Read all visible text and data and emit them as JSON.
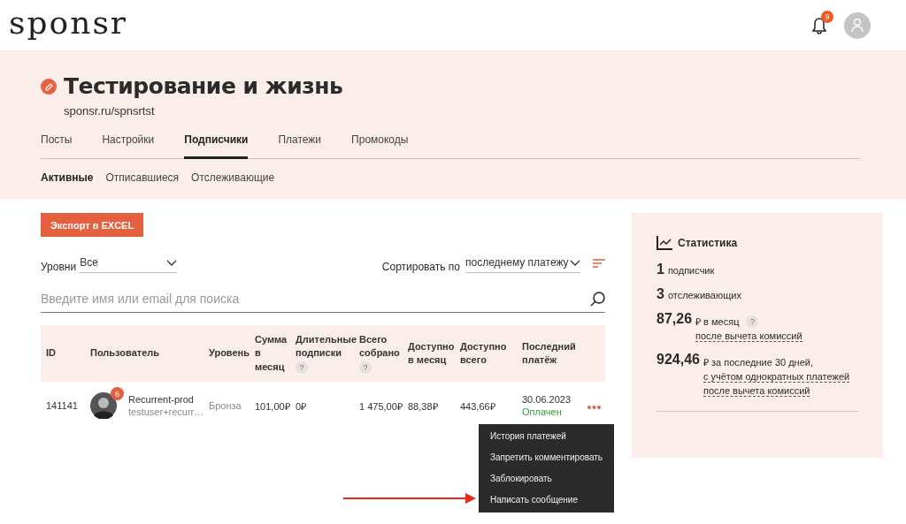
{
  "header": {
    "logo": "sponsr",
    "notification_count": "9"
  },
  "project": {
    "title": "Тестирование и жизнь",
    "url": "sponsr.ru/spnsrtst"
  },
  "tabs": [
    {
      "label": "Посты",
      "selected": false
    },
    {
      "label": "Настройки",
      "selected": false
    },
    {
      "label": "Подписчики",
      "selected": true
    },
    {
      "label": "Платежи",
      "selected": false
    },
    {
      "label": "Промокоды",
      "selected": false
    }
  ],
  "subtabs": [
    {
      "label": "Активные",
      "selected": true
    },
    {
      "label": "Отписавшиеся",
      "selected": false
    },
    {
      "label": "Отслеживающие",
      "selected": false
    }
  ],
  "export_button": "Экспорт в EXCEL",
  "filters": {
    "levels_label": "Уровни",
    "levels_value": "Все",
    "sort_label": "Сортировать по",
    "sort_value": "последнему платежу"
  },
  "search": {
    "placeholder": "Введите имя или email для поиска"
  },
  "table": {
    "columns": [
      {
        "label": "ID"
      },
      {
        "label": "Пользователь"
      },
      {
        "label": "Уровень"
      },
      {
        "label": "Сумма в месяц"
      },
      {
        "label": "Длительные подписки",
        "help": "?"
      },
      {
        "label": "Всего собрано",
        "help": "?"
      },
      {
        "label": "Доступно в месяц"
      },
      {
        "label": "Доступно всего"
      },
      {
        "label": "Последний платёж"
      }
    ],
    "rows": [
      {
        "id": "141141",
        "badge": "6",
        "name": "Recurrent-prod",
        "email": "testuser+recurr…",
        "level": "Бронза",
        "monthly": "101,00₽",
        "long_term": "0₽",
        "total": "1 475,00₽",
        "available_month": "88,38₽",
        "available_total": "443,66₽",
        "last_date": "30.06.2023",
        "status": "Оплачен",
        "paid": true
      }
    ]
  },
  "row_menu": {
    "items": [
      "История платежей",
      "Запретить комментировать",
      "Заблокировать",
      "Написать сообщение"
    ]
  },
  "stats": {
    "title": "Статистика",
    "lines": [
      {
        "value": "1",
        "text": "подписчик"
      },
      {
        "value": "3",
        "text": "отслеживающих"
      },
      {
        "value": "87,26",
        "text": "₽ в месяц",
        "help": "?",
        "notes": [
          "после вычета комиссий"
        ]
      },
      {
        "value": "924,46",
        "text": "₽ за последние 30 дней,",
        "notes": [
          "с учётом однократных платежей",
          "после вычета комиссий"
        ]
      }
    ]
  }
}
